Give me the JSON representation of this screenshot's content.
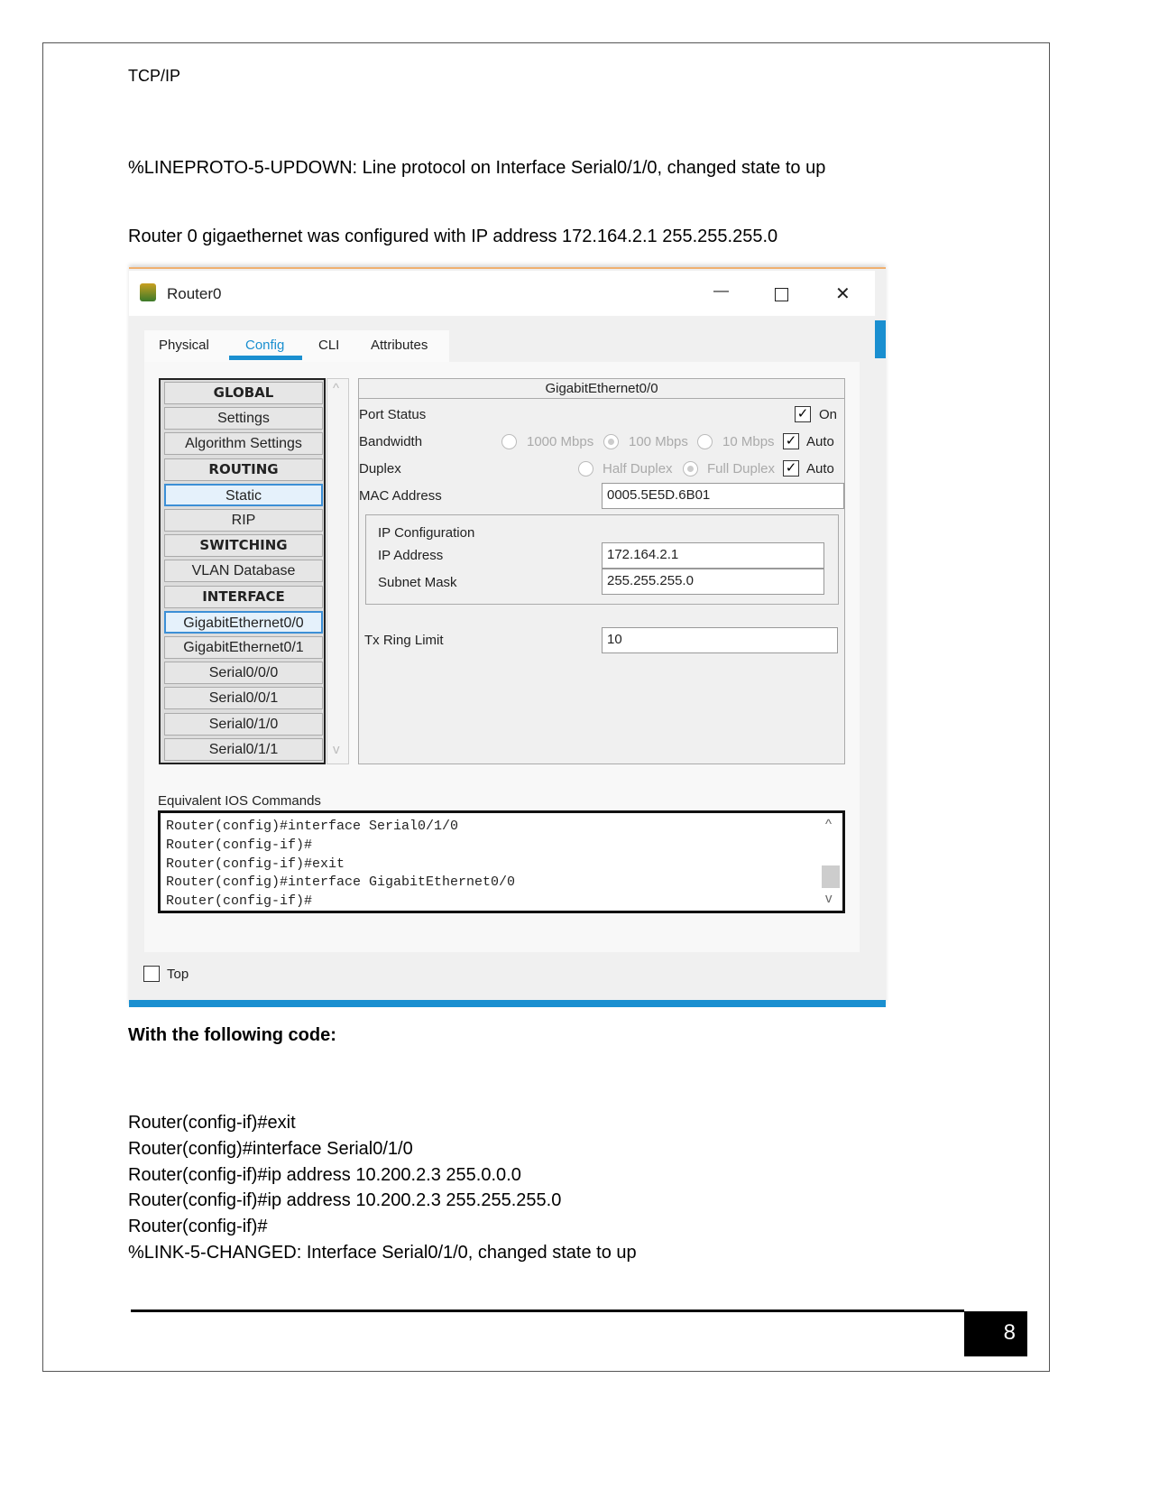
{
  "header": "TCP/IP",
  "intro_lines": [
    "%LINEPROTO-5-UPDOWN: Line protocol on Interface Serial0/1/0, changed state to up",
    "Router 0 gigaethernet was configured with IP address 172.164.2.1 255.255.255.0"
  ],
  "window": {
    "title": "Router0",
    "tabs": [
      "Physical",
      "Config",
      "CLI",
      "Attributes"
    ],
    "active_tab": "Config",
    "accent": "#1a8fd0",
    "nav": [
      {
        "label": "GLOBAL",
        "type": "header"
      },
      {
        "label": "Settings"
      },
      {
        "label": "Algorithm Settings"
      },
      {
        "label": "ROUTING",
        "type": "header"
      },
      {
        "label": "Static"
      },
      {
        "label": "RIP"
      },
      {
        "label": "SWITCHING",
        "type": "header"
      },
      {
        "label": "VLAN Database"
      },
      {
        "label": "INTERFACE",
        "type": "header"
      },
      {
        "label": "GigabitEthernet0/0"
      },
      {
        "label": "GigabitEthernet0/1"
      },
      {
        "label": "Serial0/0/0"
      },
      {
        "label": "Serial0/0/1"
      },
      {
        "label": "Serial0/1/0"
      },
      {
        "label": "Serial0/1/1"
      }
    ],
    "panel": {
      "title": "GigabitEthernet0/0",
      "port_status_label": "Port Status",
      "port_on_label": "On",
      "port_on": true,
      "bandwidth_label": "Bandwidth",
      "bw_options": [
        "1000 Mbps",
        "100 Mbps",
        "10 Mbps"
      ],
      "bw_auto_label": "Auto",
      "bw_auto": true,
      "duplex_label": "Duplex",
      "duplex_options": [
        "Half Duplex",
        "Full Duplex"
      ],
      "duplex_auto_label": "Auto",
      "duplex_auto": true,
      "mac_label": "MAC Address",
      "mac": "0005.5E5D.6B01",
      "ip_config_label": "IP Configuration",
      "ip_label": "IP Address",
      "ip": "172.164.2.1",
      "mask_label": "Subnet Mask",
      "mask": "255.255.255.0",
      "tx_label": "Tx Ring Limit",
      "tx": "10"
    },
    "ios_label": "Equivalent IOS Commands",
    "ios_lines": [
      "Router(config)#interface Serial0/1/0",
      "Router(config-if)#",
      "Router(config-if)#exit",
      "Router(config)#interface GigabitEthernet0/0",
      "Router(config-if)#"
    ],
    "top_label": "Top",
    "check_mark": "✓",
    "minimize": "—",
    "maximize": "☐",
    "close": "✕",
    "scroll_up": "^",
    "scroll_down": "v"
  },
  "code_heading": "With the following code:",
  "code_lines": [
    "Router(config-if)#exit",
    "Router(config)#interface Serial0/1/0",
    "Router(config-if)#ip address 10.200.2.3 255.0.0.0",
    "Router(config-if)#ip address 10.200.2.3 255.255.255.0",
    "Router(config-if)#",
    "%LINK-5-CHANGED: Interface Serial0/1/0, changed state to up"
  ],
  "page_number": "8"
}
